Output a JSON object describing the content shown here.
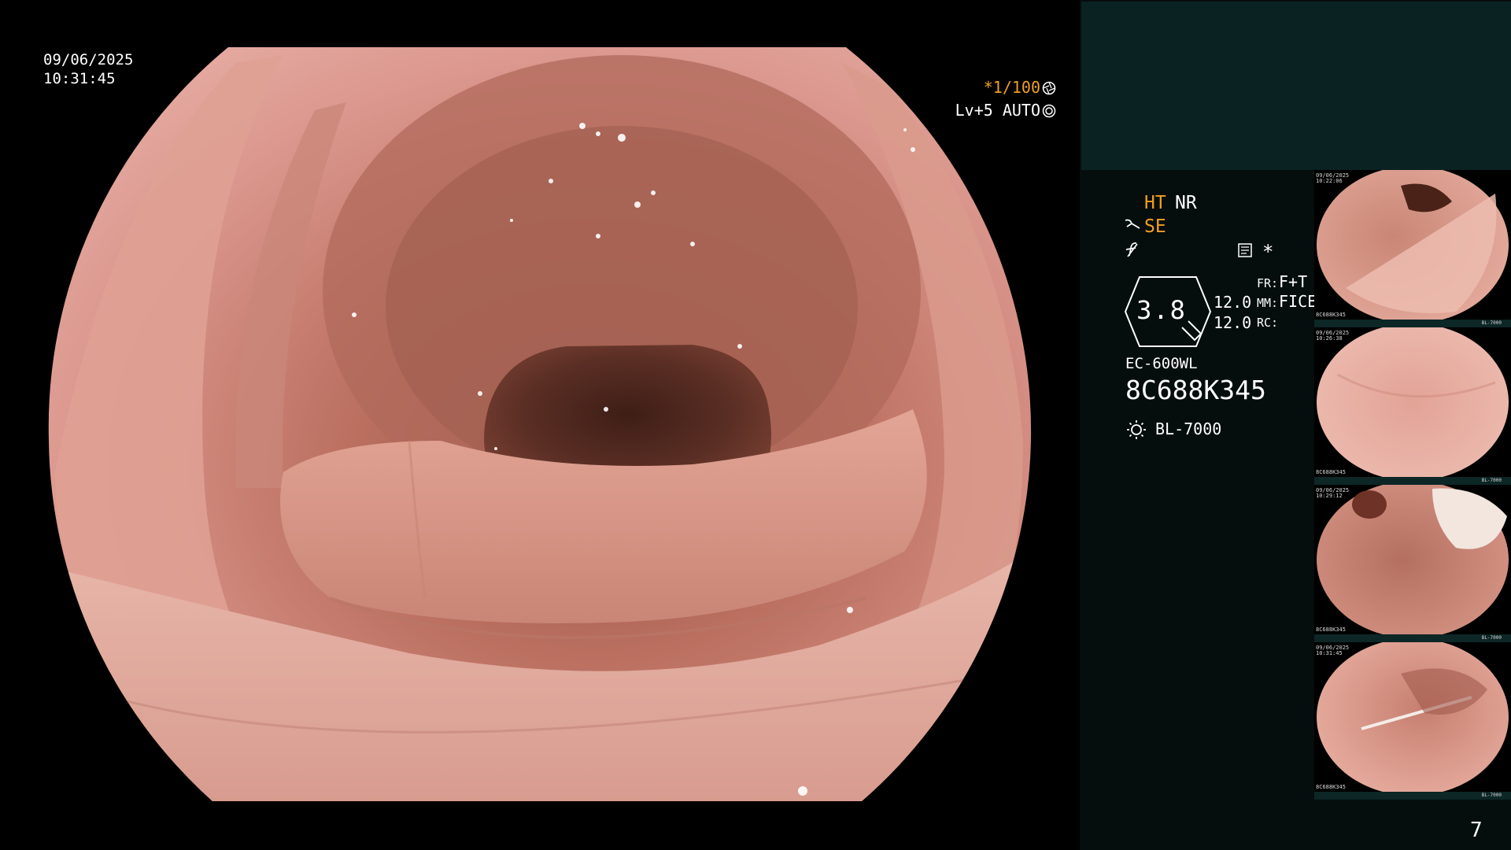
{
  "overlay": {
    "date": "09/06/2025",
    "time": "10:31:45",
    "shutter": "*1/100",
    "level": "Lv+5 AUTO"
  },
  "status": {
    "ht": "HT",
    "nr": "NR",
    "se": "SE",
    "star": "*",
    "zoom": "3.8",
    "value_a": "12.0",
    "value_b": "12.0",
    "fr_label": "FR:",
    "fr_value": "F+T",
    "mm_label": "MM:",
    "mm_value": "FICE",
    "rc_label": "RC:",
    "scope_model": "EC-600WL",
    "scope_serial": "8C688K345",
    "lamp": "BL-7000"
  },
  "thumbnails": [
    {
      "date": "09/06/2025",
      "time": "10:22:06",
      "serial": "8C688K345",
      "lamp": "BL-7000"
    },
    {
      "date": "09/06/2025",
      "time": "10:26:38",
      "serial": "8C688K345",
      "lamp": "BL-7000"
    },
    {
      "date": "09/06/2025",
      "time": "10:29:12",
      "serial": "8C688K345",
      "lamp": "BL-7000"
    },
    {
      "date": "09/06/2025",
      "time": "10:31:45",
      "serial": "8C688K345",
      "lamp": "BL-7000"
    }
  ],
  "page_number": "7",
  "colors": {
    "accent": "#f0a020",
    "text": "#ffffff",
    "panel_top": "#0b2222",
    "panel": "#060d0d"
  },
  "icons": {
    "shutter": "aperture-icon",
    "auto": "target-icon",
    "se": "scope-icon",
    "f": "f-hook-icon",
    "doc": "document-icon",
    "lamp": "sun-lamp-icon"
  }
}
